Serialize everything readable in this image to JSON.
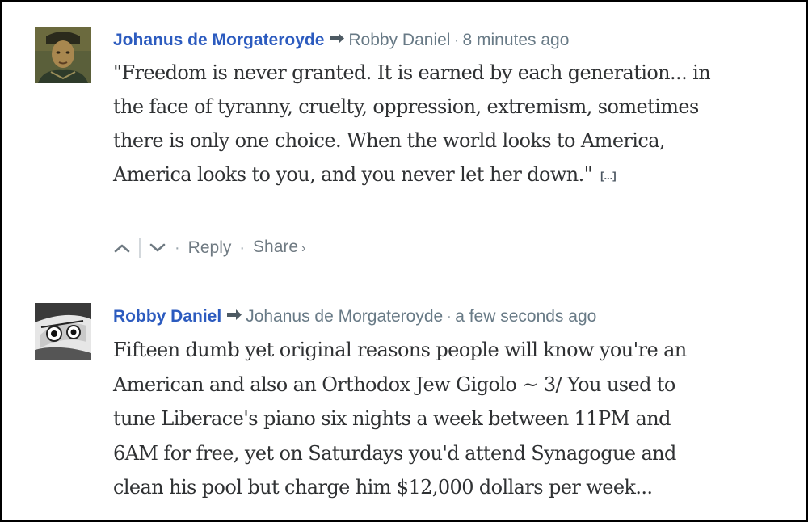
{
  "comments": [
    {
      "author": "Johanus de Morgateroyde",
      "reply_to": "Robby Daniel",
      "separator": "·",
      "time": "8 minutes ago",
      "lines": [
        "\"Freedom is never granted. It is earned by each generation... in",
        "the face of tyranny, cruelty, oppression, extremism, sometimes",
        "there is only one choice. When the world looks to America,",
        "America looks to you, and you never let her down.\""
      ],
      "expand_label": "[...]",
      "actions": {
        "upvote_icon": "chevron-up-icon",
        "downvote_icon": "chevron-down-icon",
        "reply_label": "Reply",
        "share_label": "Share",
        "share_chevron": "›",
        "dot": "·"
      }
    },
    {
      "author": "Robby Daniel",
      "reply_to": "Johanus de Morgateroyde",
      "separator": "·",
      "time": "a few seconds ago",
      "lines": [
        "Fifteen dumb yet original reasons people will know you're an",
        "American and also an Orthodox Jew Gigolo ~ 3/ You used to",
        "tune Liberace's piano six nights a week between 11PM and",
        "6AM for free, yet on Saturdays you'd attend Synagogue and",
        "clean his pool but charge him $12,000 dollars per week..."
      ]
    }
  ],
  "colors": {
    "author": "#2c5bbf",
    "meta": "#687a86",
    "text": "#2f3133",
    "border": "#000000"
  },
  "icons": {
    "reply_arrow": "reply-arrow-icon"
  }
}
